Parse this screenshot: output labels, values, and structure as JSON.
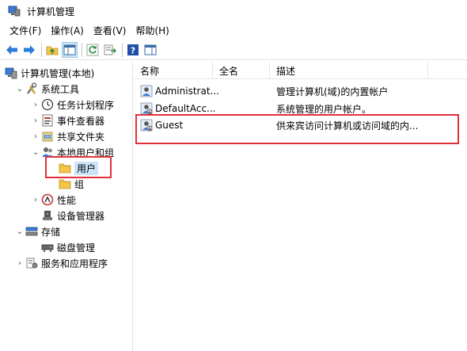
{
  "window": {
    "title": "计算机管理",
    "app_icon": "computer-management-icon"
  },
  "menu": [
    {
      "label": "文件(F)"
    },
    {
      "label": "操作(A)"
    },
    {
      "label": "查看(V)"
    },
    {
      "label": "帮助(H)"
    }
  ],
  "toolbar": {
    "buttons": [
      "back-arrow-icon",
      "forward-arrow-icon",
      "up-folder-icon",
      "show-hide-tree-icon",
      "refresh-icon",
      "export-list-icon",
      "help-icon",
      "properties-view-icon"
    ],
    "active": "show-hide-tree-icon"
  },
  "tree": {
    "items": [
      {
        "label": "计算机管理(本地)",
        "icon": "computer-management-icon",
        "expander": ""
      },
      {
        "label": "系统工具",
        "icon": "tools-icon",
        "expander": "expanded"
      },
      {
        "label": "任务计划程序",
        "icon": "clock-icon",
        "expander": "collapsed"
      },
      {
        "label": "事件查看器",
        "icon": "event-viewer-icon",
        "expander": "collapsed"
      },
      {
        "label": "共享文件夹",
        "icon": "shared-folder-icon",
        "expander": "collapsed"
      },
      {
        "label": "本地用户和组",
        "icon": "local-users-groups-icon",
        "expander": "expanded"
      },
      {
        "label": "用户",
        "icon": "folder-icon",
        "expander": "",
        "selected": true
      },
      {
        "label": "组",
        "icon": "folder-icon",
        "expander": ""
      },
      {
        "label": "性能",
        "icon": "performance-icon",
        "expander": "collapsed"
      },
      {
        "label": "设备管理器",
        "icon": "device-manager-icon",
        "expander": ""
      },
      {
        "label": "存储",
        "icon": "storage-icon",
        "expander": "expanded"
      },
      {
        "label": "磁盘管理",
        "icon": "disk-management-icon",
        "expander": ""
      },
      {
        "label": "服务和应用程序",
        "icon": "services-icon",
        "expander": "collapsed"
      }
    ]
  },
  "list": {
    "columns": [
      "名称",
      "全名",
      "描述"
    ],
    "rows": [
      {
        "name": "Administrat...",
        "fullname": "",
        "description": "管理计算机(域)的内置帐户",
        "icon": "user-icon"
      },
      {
        "name": "DefaultAcc...",
        "fullname": "",
        "description": "系统管理的用户帐户。",
        "icon": "user-disabled-icon"
      },
      {
        "name": "Guest",
        "fullname": "",
        "description": "供来宾访问计算机或访问域的内...",
        "icon": "user-disabled-icon"
      }
    ]
  },
  "colors": {
    "highlight": "#e0313a",
    "selection": "#cce4f7",
    "folder": "#f5c54a"
  }
}
